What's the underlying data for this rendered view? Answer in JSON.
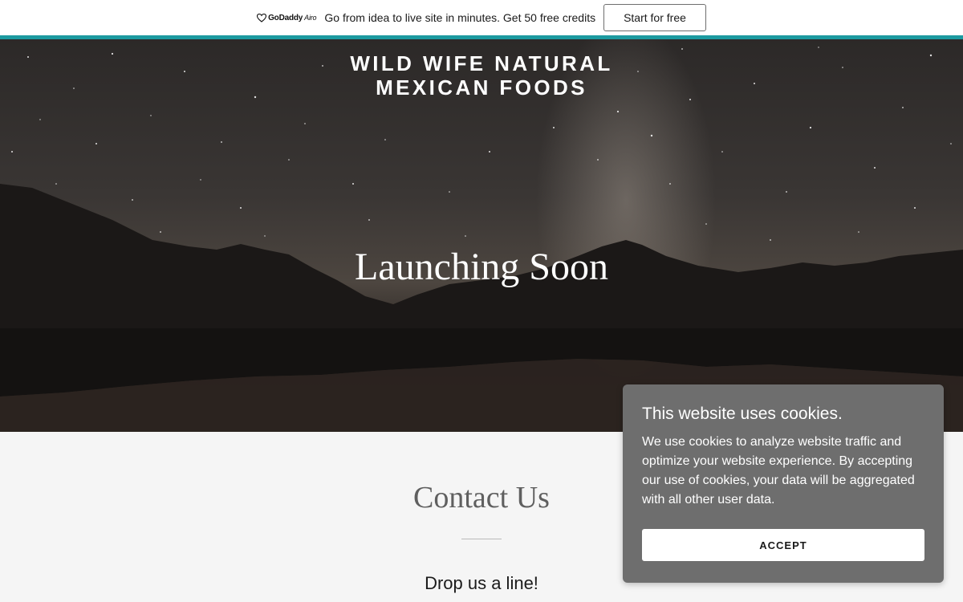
{
  "promo": {
    "logo_text": "GoDaddy",
    "logo_sub": "Airo",
    "message": "Go from idea to live site in minutes. Get 50 free credits",
    "button_label": "Start for free",
    "accent_color": "#1c9aa0"
  },
  "hero": {
    "site_title_line1": "WILD WIFE NATURAL",
    "site_title_line2": "MEXICAN FOODS",
    "heading": "Launching Soon"
  },
  "contact": {
    "title": "Contact Us",
    "subtitle": "Drop us a line!"
  },
  "cookie": {
    "title": "This website uses cookies.",
    "body": "We use cookies to analyze website traffic and optimize your website experience. By accepting our use of cookies, your data will be aggregated with all other user data.",
    "accept_label": "ACCEPT"
  }
}
